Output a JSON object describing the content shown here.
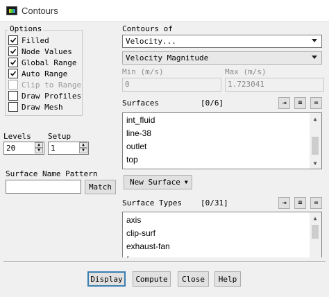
{
  "window": {
    "title": "Contours"
  },
  "options": {
    "legend": "Options",
    "items": [
      {
        "label": "Filled",
        "checked": true,
        "enabled": true
      },
      {
        "label": "Node Values",
        "checked": true,
        "enabled": true
      },
      {
        "label": "Global Range",
        "checked": true,
        "enabled": true
      },
      {
        "label": "Auto Range",
        "checked": true,
        "enabled": true
      },
      {
        "label": "Clip to Range",
        "checked": false,
        "enabled": false
      },
      {
        "label": "Draw Profiles",
        "checked": false,
        "enabled": true
      },
      {
        "label": "Draw Mesh",
        "checked": false,
        "enabled": true
      }
    ]
  },
  "levels": {
    "label": "Levels",
    "value": "20"
  },
  "setup": {
    "label": "Setup",
    "value": "1"
  },
  "surface_name_pattern": {
    "label": "Surface Name Pattern",
    "value": "",
    "match_label": "Match"
  },
  "contours_of": {
    "label": "Contours of",
    "category": "Velocity...",
    "quantity": "Velocity Magnitude",
    "min_label": "Min (m/s)",
    "max_label": "Max (m/s)",
    "min_value": "0",
    "max_value": "1.723041"
  },
  "surfaces": {
    "label": "Surfaces",
    "count": "[0/6]",
    "items": [
      "int_fluid",
      "line-38",
      "outlet",
      "top"
    ],
    "new_surface_label": "New Surface"
  },
  "surface_types": {
    "label": "Surface Types",
    "count": "[0/31]",
    "items": [
      "axis",
      "clip-surf",
      "exhaust-fan",
      "f"
    ]
  },
  "buttons": {
    "display": "Display",
    "compute": "Compute",
    "close": "Close",
    "help": "Help"
  }
}
